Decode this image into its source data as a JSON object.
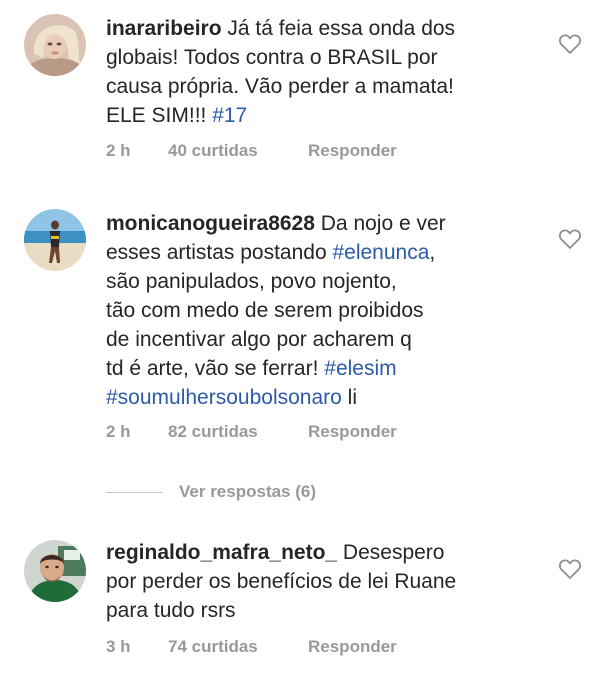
{
  "comments": [
    {
      "username": "inararibeiro",
      "lines": [
        [
          {
            "t": "Já tá feia essa onda dos"
          }
        ],
        [
          {
            "t": "globais! Todos contra o BRASIL por"
          }
        ],
        [
          {
            "t": "causa própria. Vão perder a mamata!"
          }
        ],
        [
          {
            "t": "ELE SIM!!! "
          },
          {
            "t": "#17",
            "tag": true
          }
        ]
      ],
      "time": "2 h",
      "likes": "40 curtidas",
      "reply_label": "Responder"
    },
    {
      "username": "monicanogueira8628",
      "lines": [
        [
          {
            "t": "Da nojo e ver"
          }
        ],
        [
          {
            "t": "esses artistas postando "
          },
          {
            "t": "#elenunca",
            "tag": true
          },
          {
            "t": ","
          }
        ],
        [
          {
            "t": "são panipulados, povo nojento,"
          }
        ],
        [
          {
            "t": "tão com medo de serem proibidos"
          }
        ],
        [
          {
            "t": "de incentivar algo por acharem q"
          }
        ],
        [
          {
            "t": "td é arte, vão se ferrar! "
          },
          {
            "t": "#elesim",
            "tag": true
          }
        ],
        [
          {
            "t": "#soumulhersoubolsonaro",
            "tag": true
          },
          {
            "t": " li"
          }
        ]
      ],
      "time": "2 h",
      "likes": "82 curtidas",
      "reply_label": "Responder"
    },
    {
      "username": "reginaldo_mafra_neto_",
      "lines": [
        [
          {
            "t": "Desespero"
          }
        ],
        [
          {
            "t": "por perder os benefícios de lei Ruane"
          }
        ],
        [
          {
            "t": "para tudo rsrs"
          }
        ]
      ],
      "time": "3 h",
      "likes": "74 curtidas",
      "reply_label": "Responder"
    }
  ],
  "view_replies_label": "Ver respostas (6)",
  "icons": {
    "like": "heart-outline-icon"
  },
  "colors": {
    "hashtag": "#2b5ba8",
    "meta": "#999999",
    "text": "#262626"
  }
}
